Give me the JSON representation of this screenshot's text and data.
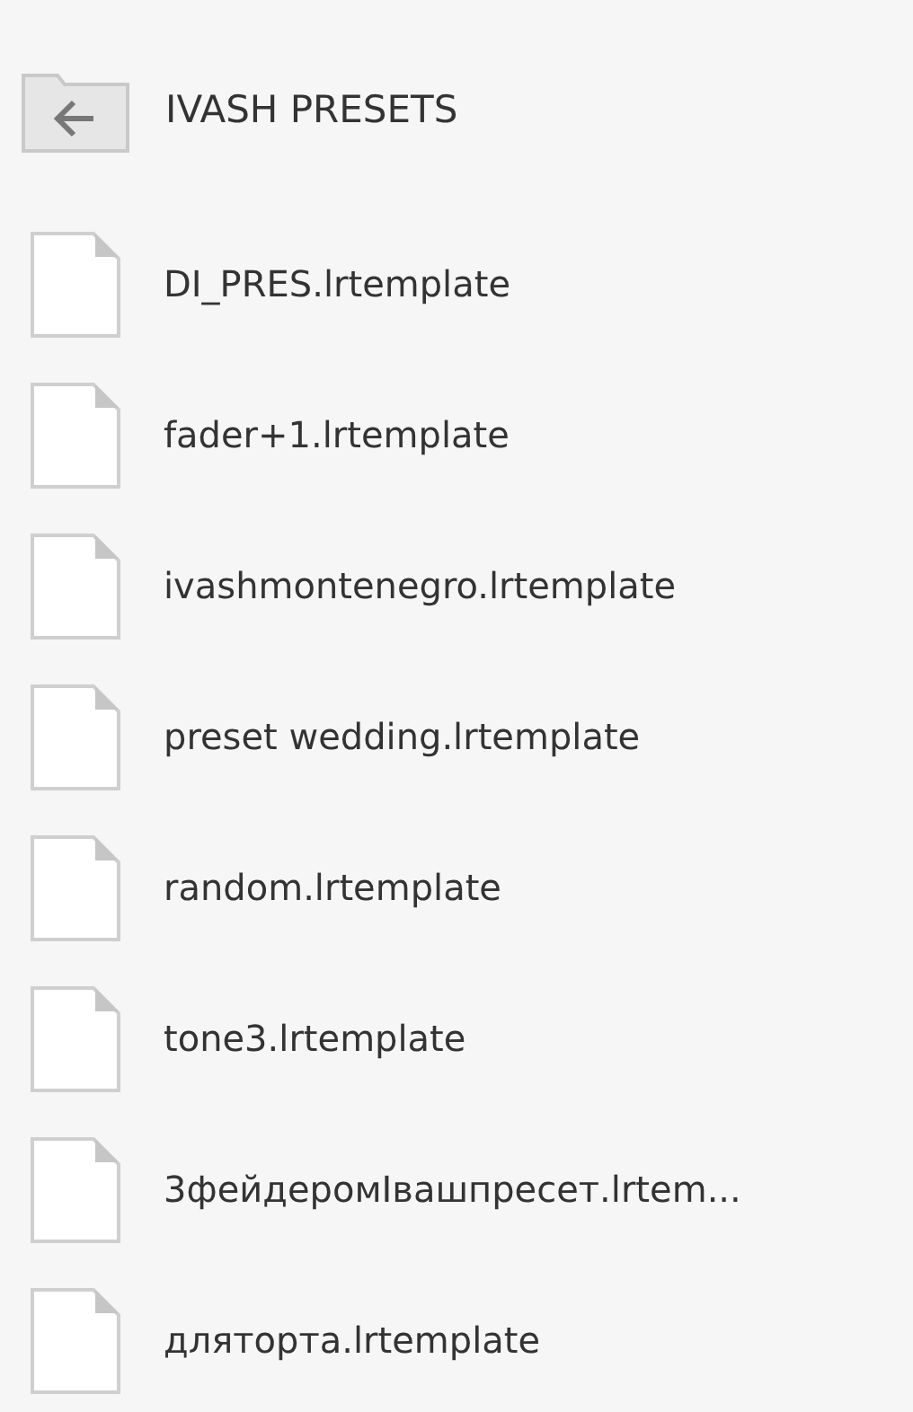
{
  "folder": {
    "title": "IVASH PRESETS"
  },
  "files": [
    {
      "name": "DI_PRES.lrtemplate"
    },
    {
      "name": "fader+1.lrtemplate"
    },
    {
      "name": "ivashmontenegro.lrtemplate"
    },
    {
      "name": "preset wedding.lrtemplate"
    },
    {
      "name": "random.lrtemplate"
    },
    {
      "name": "tone3.lrtemplate"
    },
    {
      "name": "3фейдеромIвашпресет.lrtem..."
    },
    {
      "name": "дляторта.lrtemplate"
    }
  ]
}
